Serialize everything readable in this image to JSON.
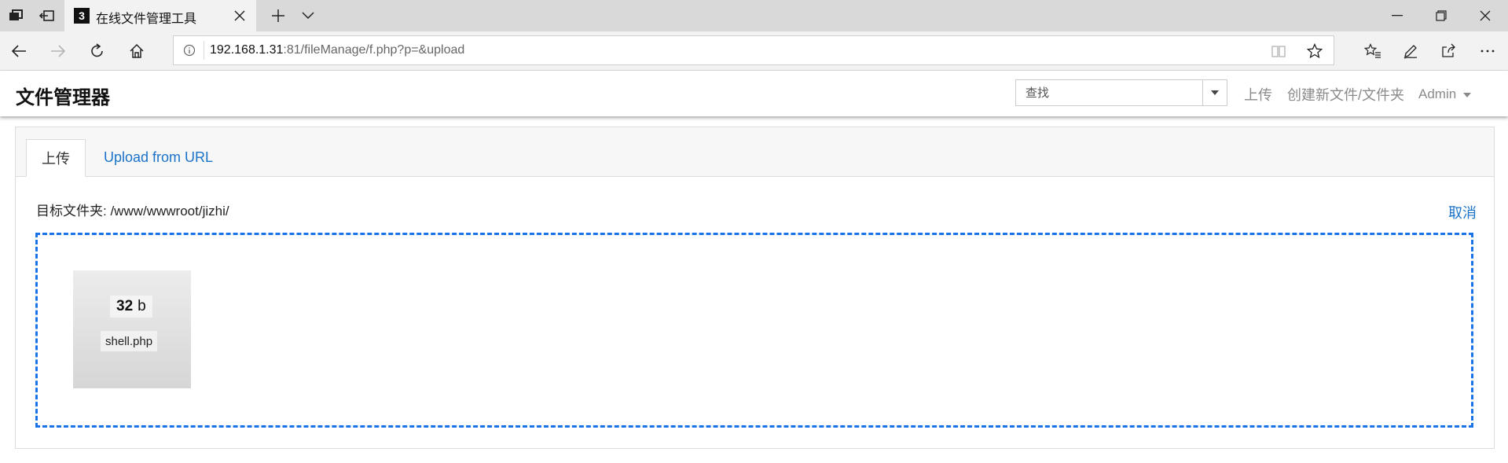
{
  "browser": {
    "tab_title": "在线文件管理工具",
    "tab_favicon_char": "3",
    "url": {
      "host": "192.168.1.31",
      "rest": ":81/fileManage/f.php?p=&upload"
    },
    "icons": {
      "tab_actions": "tab-actions-icon",
      "back_tabs": "set-aside-tabs-icon",
      "new_tab": "plus-icon",
      "tab_list": "chevron-down-icon",
      "minimize": "minimize-icon",
      "restore": "restore-icon",
      "close": "close-icon",
      "back": "arrow-left-icon",
      "forward": "arrow-right-icon",
      "refresh": "refresh-icon",
      "home": "home-icon",
      "site_info": "info-icon",
      "reading_view": "book-icon",
      "favorite": "star-icon",
      "favorites_list": "favorites-icon",
      "notes": "pen-icon",
      "share": "share-icon",
      "more": "more-icon"
    }
  },
  "app": {
    "brand": "文件管理器",
    "search_placeholder": "查找",
    "nav": {
      "upload": "上传",
      "create": "创建新文件/文件夹",
      "user": "Admin"
    }
  },
  "upload_panel": {
    "tabs": {
      "upload": "上传",
      "from_url": "Upload from URL"
    },
    "target_label": "目标文件夹: /www/wwwroot/jizhi/",
    "cancel": "取消",
    "file": {
      "size_value": "32",
      "size_unit": "b",
      "name": "shell.php"
    }
  },
  "colors": {
    "accent": "#1a73c9",
    "dropzone_border": "#1a73e8"
  }
}
